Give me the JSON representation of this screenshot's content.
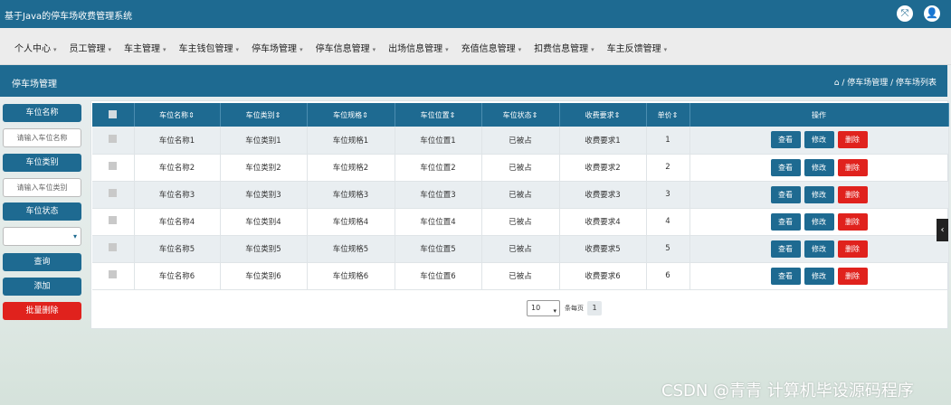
{
  "app": {
    "title": "基于Java的停车场收费管理系统"
  },
  "topbar_icons": [
    "expand-icon",
    "user-icon"
  ],
  "menu": [
    {
      "label": "个人中心"
    },
    {
      "label": "员工管理"
    },
    {
      "label": "车主管理"
    },
    {
      "label": "车主钱包管理"
    },
    {
      "label": "停车场管理"
    },
    {
      "label": "停车信息管理"
    },
    {
      "label": "出场信息管理"
    },
    {
      "label": "充值信息管理"
    },
    {
      "label": "扣费信息管理"
    },
    {
      "label": "车主反馈管理"
    }
  ],
  "page": {
    "title": "停车场管理",
    "breadcrumb": " / 停车场管理 / 停车场列表"
  },
  "sidebar": {
    "name_label": "车位名称",
    "name_placeholder": "请输入车位名称",
    "type_label": "车位类别",
    "type_placeholder": "请输入车位类别",
    "status_label": "车位状态",
    "status_value": "",
    "search_btn": "查询",
    "add_btn": "添加",
    "batch_delete_btn": "批量删除"
  },
  "table": {
    "columns": [
      "车位名称",
      "车位类别",
      "车位规格",
      "车位位置",
      "车位状态",
      "收费要求",
      "单价",
      "操作"
    ],
    "rows": [
      [
        "车位名称1",
        "车位类别1",
        "车位规格1",
        "车位位置1",
        "已被占",
        "收费要求1",
        "1"
      ],
      [
        "车位名称2",
        "车位类别2",
        "车位规格2",
        "车位位置2",
        "已被占",
        "收费要求2",
        "2"
      ],
      [
        "车位名称3",
        "车位类别3",
        "车位规格3",
        "车位位置3",
        "已被占",
        "收费要求3",
        "3"
      ],
      [
        "车位名称4",
        "车位类别4",
        "车位规格4",
        "车位位置4",
        "已被占",
        "收费要求4",
        "4"
      ],
      [
        "车位名称5",
        "车位类别5",
        "车位规格5",
        "车位位置5",
        "已被占",
        "收费要求5",
        "5"
      ],
      [
        "车位名称6",
        "车位类别6",
        "车位规格6",
        "车位位置6",
        "已被占",
        "收费要求6",
        "6"
      ]
    ],
    "actions": {
      "view": "查看",
      "edit": "修改",
      "delete": "删除"
    },
    "sort_mark": "⇕"
  },
  "pager": {
    "page_size": "10",
    "per_page_label": "条每页",
    "current_page": "1"
  },
  "watermark": "CSDN @青青  计算机毕设源码程序",
  "colors": {
    "primary": "#1e6a91",
    "danger": "#e0221d"
  }
}
